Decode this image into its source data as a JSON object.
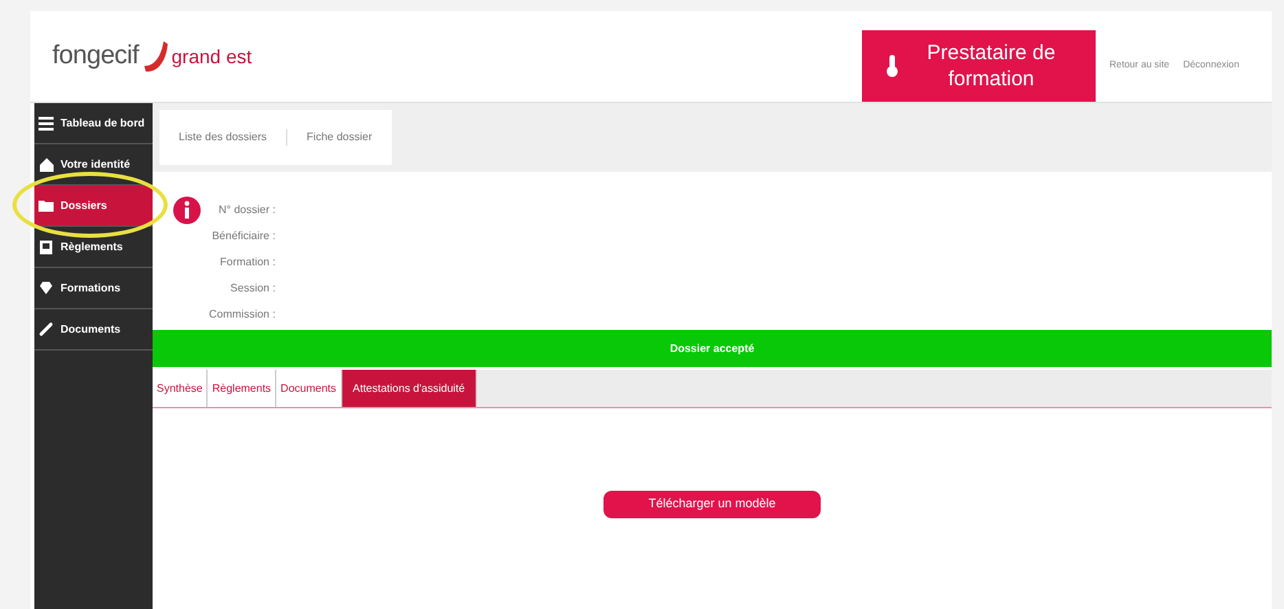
{
  "header": {
    "logo": {
      "left": "fongecif",
      "right": "grand est"
    },
    "profile": "Prestataire de formation",
    "links": [
      "Retour au site",
      "Déconnexion"
    ]
  },
  "sidebar": {
    "items": [
      {
        "label": "Tableau de bord",
        "selected": false,
        "highlighted": false
      },
      {
        "label": "Votre identité",
        "selected": false,
        "highlighted": false
      },
      {
        "label": "Dossiers",
        "selected": true,
        "highlighted": true
      },
      {
        "label": "Règlements",
        "selected": false,
        "highlighted": false
      },
      {
        "label": "Formations",
        "selected": false,
        "highlighted": false
      },
      {
        "label": "Documents",
        "selected": false,
        "highlighted": false
      }
    ]
  },
  "breadcrumb": [
    "Liste des dossiers",
    "Fiche dossier"
  ],
  "details": [
    "N° dossier :",
    "Bénéficiaire :",
    "Formation :",
    "Session :",
    "Commission :"
  ],
  "status_banner": "Dossier accepté",
  "tabs": [
    {
      "label": "Synthèse",
      "selected": false
    },
    {
      "label": "Règlements",
      "selected": false
    },
    {
      "label": "Documents",
      "selected": false
    },
    {
      "label": "Attestations d'assiduité",
      "selected": true
    }
  ],
  "download_button": "Télécharger un modèle"
}
